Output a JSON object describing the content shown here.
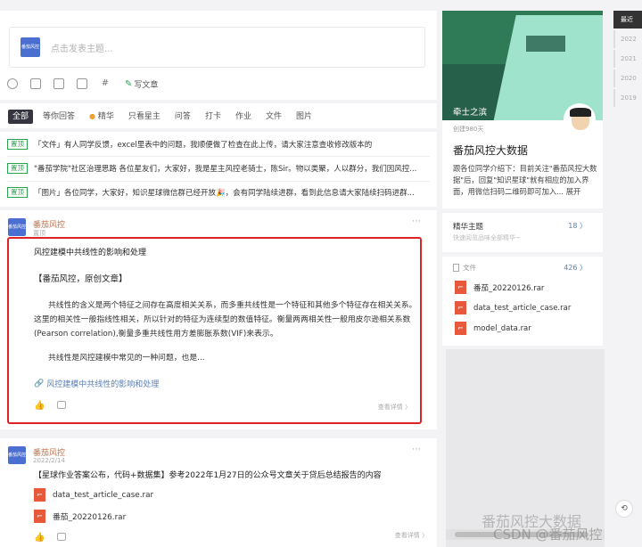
{
  "composer": {
    "avatar_text": "番茄风控",
    "placeholder": "点击发表主题...",
    "write_label": "写文章"
  },
  "tabs": [
    "全部",
    "等你回答",
    "精华",
    "只看星主",
    "问答",
    "打卡",
    "作业",
    "文件",
    "图片"
  ],
  "notices": [
    {
      "tag": "置顶",
      "text": "「文件」有人同学反馈，excel里表中的问题，我顺便做了检查在此上传，请大家注意查收修改版本的"
    },
    {
      "tag": "置顶",
      "text": "\"番茄学院\"社区治理思路 各位星友们，大家好，我是星主风控老骑士，陈Sir。物以类聚，人以群分，我们因风控..."
    },
    {
      "tag": "置顶",
      "text": "「图片」各位同学，大家好，知识星球微信群已经开放🎉，会有同学陆续进群，看到此信息请大家陆续扫码进群..."
    }
  ],
  "post1": {
    "author": "番茄风控",
    "date": "置顶",
    "avatar_text": "番茄风控",
    "title": "风控建模中共线性的影响和处理",
    "tagline": "【番茄风控，原创文章】",
    "body": "共线性的含义是两个特征之间存在高度相关关系，而多重共线性是一个特征和其他多个特征存在相关关系。这里的相关性一般指线性相关，所以针对的特征为连续型的数值特征。衡量两两相关性一般用皮尔逊相关系数(Pearson correlation),衡量多重共线性用方差膨胀系数(VIF)来表示。",
    "body2": "共线性是风控建模中常见的一种问题，也是...",
    "link": "风控建模中共线性的影响和处理",
    "detail": "查看详情 〉"
  },
  "post2": {
    "author": "番茄风控",
    "date": "2022/2/14",
    "avatar_text": "番茄风控",
    "title": "【星球作业答案公布，代码+数据集】参考2022年1月27日的公众号文章关于贷后总结报告的内容",
    "files": [
      "data_test_article_case.rar",
      "番茄_20220126.rar"
    ],
    "detail": "查看详情 〉"
  },
  "sidebar": {
    "cover_name": "牵士之滨",
    "days": "创建980天",
    "title": "番茄风控大数据",
    "desc": "跟各位同学介绍下：目前关注\"番茄风控大数据\"后，回复\"知识星球\"就有相应的加入界面，用微信扫码二维码即可加入... 展开",
    "featured_label": "精华主题",
    "featured_count": "18 〉",
    "featured_sub": "快速阅览品味全部精华~",
    "files_label": "文件",
    "files_count": "426 〉",
    "files": [
      "番茄_20220126.rar",
      "data_test_article_case.rar",
      "model_data.rar"
    ]
  },
  "years": [
    "最近",
    "2022",
    "2021",
    "2020",
    "2019"
  ],
  "watermark": {
    "line1": "番茄风控大数据",
    "line2": "CSDN @番茄风控"
  }
}
